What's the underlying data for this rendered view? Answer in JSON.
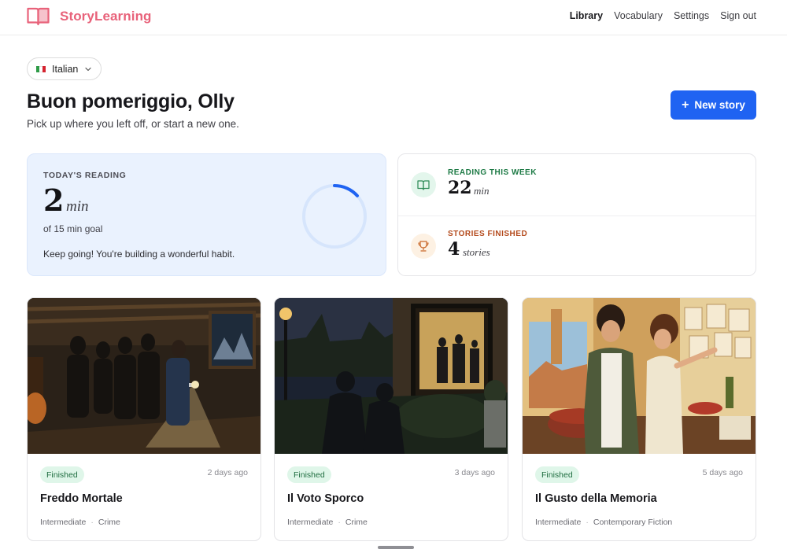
{
  "app": {
    "name": "StoryLearning"
  },
  "nav": [
    {
      "label": "Library",
      "active": true
    },
    {
      "label": "Vocabulary",
      "active": false
    },
    {
      "label": "Settings",
      "active": false
    },
    {
      "label": "Sign out",
      "active": false
    }
  ],
  "language": {
    "selected": "Italian",
    "flag_colors": [
      "#2e9b47",
      "#ffffff",
      "#d5232f"
    ]
  },
  "greeting": "Buon pomeriggio, Olly",
  "subtitle": "Pick up where you left off, or start a new one.",
  "new_story_button": {
    "icon": "+",
    "label": "New story"
  },
  "today": {
    "label": "TODAY'S READING",
    "value": "2",
    "unit": "min",
    "goal_text": "of 15 min goal",
    "note": "Keep going! You're building a wonderful habit.",
    "progress_fraction": 0.133
  },
  "stats": {
    "week": {
      "label": "READING THIS WEEK",
      "value": "22",
      "unit": "min",
      "icon": "open-book-icon",
      "color": "#1d7a45"
    },
    "finished": {
      "label": "STORIES FINISHED",
      "value": "4",
      "unit": "stories",
      "icon": "trophy-icon",
      "color": "#b44a1c"
    }
  },
  "stories": [
    {
      "status": "Finished",
      "time": "2 days ago",
      "title": "Freddo Mortale",
      "level": "Intermediate",
      "genre": "Crime"
    },
    {
      "status": "Finished",
      "time": "3 days ago",
      "title": "Il Voto Sporco",
      "level": "Intermediate",
      "genre": "Crime"
    },
    {
      "status": "Finished",
      "time": "5 days ago",
      "title": "Il Gusto della Memoria",
      "level": "Intermediate",
      "genre": "Contemporary Fiction"
    }
  ],
  "colors": {
    "brand": "#e8627a",
    "accent": "#1f63f2",
    "today_bg": "#eaf2fe",
    "finished_badge": "#dff6e9"
  }
}
